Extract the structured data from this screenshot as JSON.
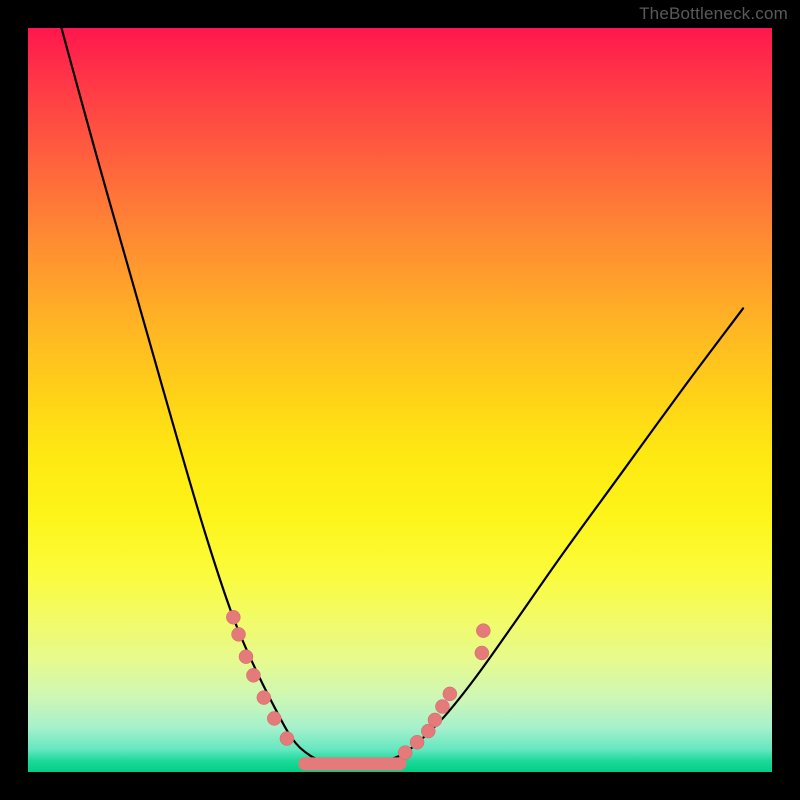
{
  "watermark": "TheBottleneck.com",
  "colors": {
    "curve_stroke": "#000000",
    "marker_fill": "#e47a7a",
    "marker_stroke": "#d06868",
    "green_band": "#1cd99a"
  },
  "chart_data": {
    "type": "line",
    "title": "",
    "xlabel": "",
    "ylabel": "",
    "xlim": [
      0,
      1
    ],
    "ylim": [
      0,
      1
    ],
    "note": "Bottleneck-style V curve. No axes/ticks shown. x and y are normalized plot-area fractions; y=0 is top, y=1 is bottom. Left branch descends steeply, wide flat minimum around x≈0.37–0.50, right branch rises with gentler slope toward ~y≈0.36.",
    "series": [
      {
        "name": "bottleneck-curve",
        "x": [
          0.045,
          0.08,
          0.12,
          0.16,
          0.2,
          0.24,
          0.275,
          0.305,
          0.335,
          0.355,
          0.375,
          0.395,
          0.42,
          0.45,
          0.48,
          0.505,
          0.53,
          0.56,
          0.6,
          0.65,
          0.72,
          0.8,
          0.88,
          0.955
        ],
        "y": [
          0.0,
          0.13,
          0.27,
          0.41,
          0.55,
          0.685,
          0.79,
          0.86,
          0.92,
          0.955,
          0.975,
          0.985,
          0.99,
          0.99,
          0.985,
          0.975,
          0.955,
          0.925,
          0.875,
          0.805,
          0.705,
          0.595,
          0.485,
          0.385
        ]
      }
    ],
    "markers_left": [
      {
        "x": 0.276,
        "y": 0.792
      },
      {
        "x": 0.283,
        "y": 0.815
      },
      {
        "x": 0.293,
        "y": 0.845
      },
      {
        "x": 0.303,
        "y": 0.87
      },
      {
        "x": 0.317,
        "y": 0.9
      },
      {
        "x": 0.331,
        "y": 0.928
      },
      {
        "x": 0.348,
        "y": 0.955
      }
    ],
    "markers_right": [
      {
        "x": 0.507,
        "y": 0.974
      },
      {
        "x": 0.523,
        "y": 0.96
      },
      {
        "x": 0.538,
        "y": 0.945
      },
      {
        "x": 0.547,
        "y": 0.93
      },
      {
        "x": 0.557,
        "y": 0.912
      },
      {
        "x": 0.567,
        "y": 0.895
      },
      {
        "x": 0.61,
        "y": 0.84
      },
      {
        "x": 0.612,
        "y": 0.81
      }
    ],
    "flat_segment": {
      "x0": 0.372,
      "x1": 0.5,
      "y": 0.989
    }
  }
}
